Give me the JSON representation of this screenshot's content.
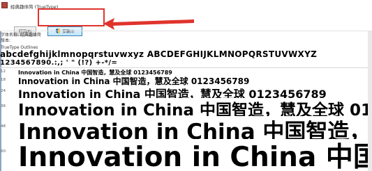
{
  "window": {
    "title": "经典趣体简 (TrueType)"
  },
  "toolbar": {
    "print_label": "打印(P)",
    "install_label": "安装(I)"
  },
  "info": {
    "font_name": "字体名称: 经典趣体简",
    "version": "版本:",
    "type": "TrueType Outlines"
  },
  "sample": {
    "alphabet": "abcdefghijklmnopqrstuvwxyz ABCDEFGHIJKLMNOPQRSTUVWXYZ",
    "digits": "1234567890.:,; ' \" (!?) +-*/=",
    "rows": [
      {
        "size": "12",
        "text": "Innovation in China 中国智造，慧及全球 0123456789"
      },
      {
        "size": "18",
        "text": "Innovation in China 中国智造，慧及全球 0123456789"
      },
      {
        "size": "24",
        "text": "Innovation in China 中国智造，慧及全球 0123456789"
      },
      {
        "size": "36",
        "text": "Innovation in China 中国智造，慧及全球 0123456789"
      },
      {
        "size": "48",
        "text": "Innovation in China 中国智造，慧及全球"
      },
      {
        "size": "60",
        "text": "Innovation in China 中国智造"
      }
    ]
  },
  "annotation": {
    "highlight_color": "#e0332c"
  }
}
